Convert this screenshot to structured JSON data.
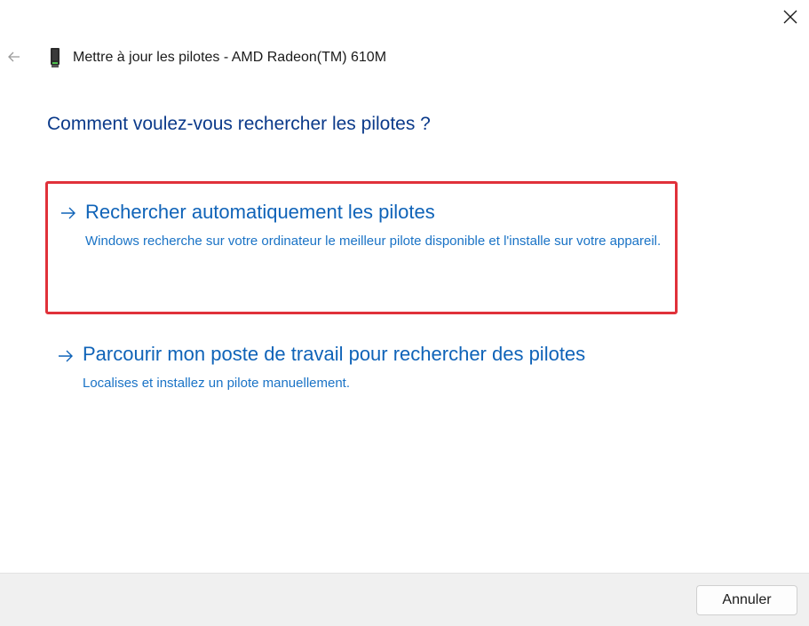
{
  "window": {
    "title": "Mettre à jour les pilotes - AMD Radeon(TM) 610M",
    "device_icon": "graphics-card-icon"
  },
  "main": {
    "heading": "Comment voulez-vous rechercher les pilotes ?",
    "options": [
      {
        "title": "Rechercher automatiquement les pilotes",
        "description": "Windows recherche sur votre ordinateur le meilleur pilote disponible et l'installe sur votre appareil.",
        "icon": "arrow-right-icon",
        "highlighted": true
      },
      {
        "title": "Parcourir mon poste de travail pour rechercher des pilotes",
        "description": "Localises et installez un pilote manuellement.",
        "icon": "arrow-right-icon",
        "highlighted": false
      }
    ]
  },
  "footer": {
    "cancel_label": "Annuler"
  },
  "colors": {
    "heading": "#0b3a8a",
    "link_title": "#0f63b8",
    "link_desc": "#1a73c6",
    "highlight_border": "#e0313a",
    "footer_bg": "#f0f0f0"
  }
}
